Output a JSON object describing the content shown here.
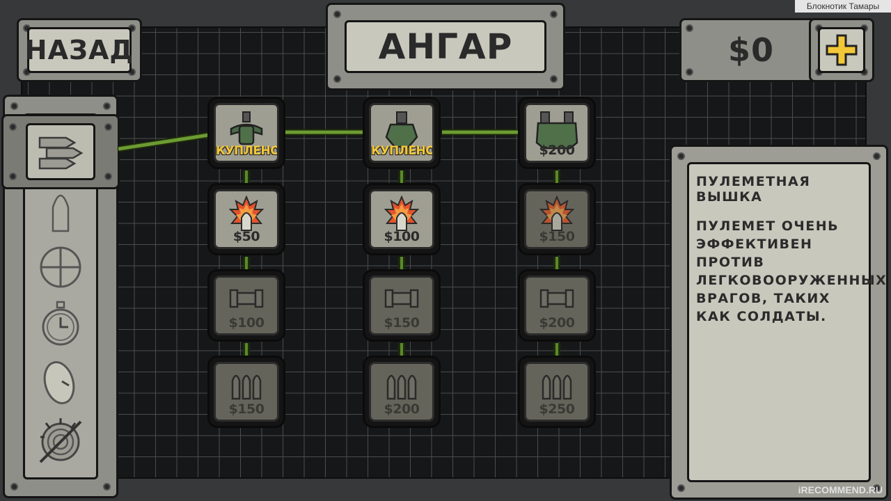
{
  "watermark": {
    "top": "Блокнотик Тамары",
    "bottom": "iRECOMMEND.RU"
  },
  "header": {
    "back_label": "НАЗАД",
    "title": "АНГАР",
    "money": "$0",
    "add_money_icon": "plus-icon"
  },
  "colors": {
    "bought": "#f3c838",
    "plus": "#f3c838",
    "link": "#5b8a2a"
  },
  "categories": [
    {
      "name": "bullets-icon",
      "selected": true
    },
    {
      "name": "shell-icon"
    },
    {
      "name": "crosshair-icon"
    },
    {
      "name": "stopwatch-icon"
    },
    {
      "name": "radar-dish-icon"
    },
    {
      "name": "mine-radar-icon"
    }
  ],
  "tree": {
    "col1": {
      "turret": "КУПЛЕНО",
      "fire": "$50",
      "barrel": "$100",
      "ammo": "$150"
    },
    "col2": {
      "turret": "КУПЛЕНО",
      "fire": "$100",
      "barrel": "$150",
      "ammo": "$200"
    },
    "col3": {
      "turret": "$200",
      "fire": "$150",
      "barrel": "$200",
      "ammo": "$250"
    }
  },
  "description": {
    "title": "ПУЛЕМЕТНАЯ ВЫШКА",
    "body": "ПУЛЕМЕТ ОЧЕНЬ ЭФФЕКТИВЕН ПРОТИВ ЛЕГКОВООРУЖЕННЫХ ВРАГОВ, ТАКИХ КАК СОЛДАТЫ."
  }
}
